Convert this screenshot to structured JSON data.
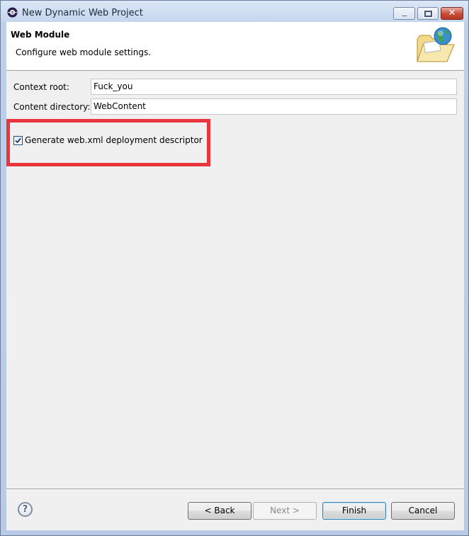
{
  "window": {
    "title": "New Dynamic Web Project",
    "icons": [
      "eclipse-icon",
      "minimize-icon",
      "maximize-icon",
      "close-icon"
    ]
  },
  "header": {
    "title": "Web Module",
    "description": "Configure web module settings.",
    "banner_icon": "web-folder-globe-icon"
  },
  "form": {
    "context_root_label": "Context root:",
    "context_root_value": "Fuck_you",
    "content_dir_label": "Content directory:",
    "content_dir_value": "WebContent",
    "generate_descriptor_label": "Generate web.xml deployment descriptor",
    "generate_descriptor_checked": true
  },
  "footer": {
    "help_glyph": "?",
    "back_label": "< Back",
    "next_label": "Next >",
    "finish_label": "Finish",
    "cancel_label": "Cancel"
  },
  "colors": {
    "highlight": "#e8363c",
    "default_button": "#3c7fb1"
  }
}
